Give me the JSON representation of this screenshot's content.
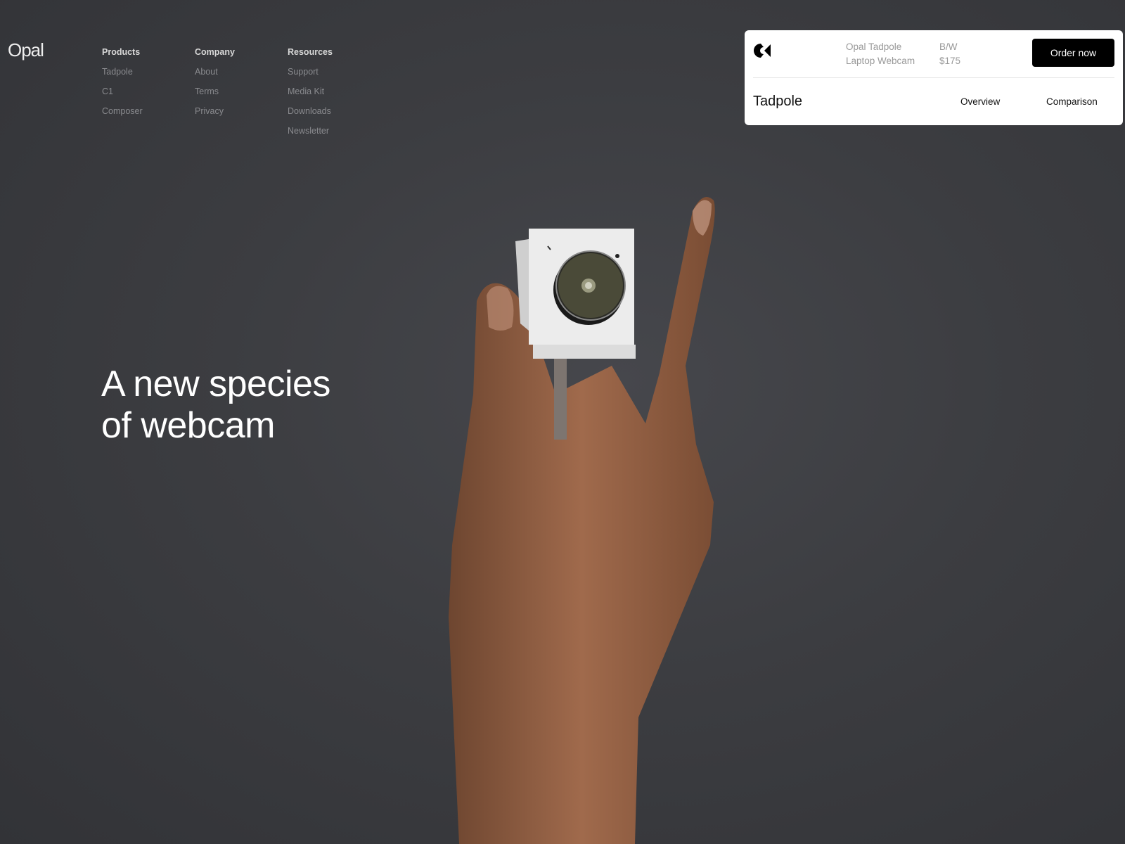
{
  "brand": {
    "logo": "Opal"
  },
  "nav": {
    "columns": [
      {
        "heading": "Products",
        "links": [
          "Tadpole",
          "C1",
          "Composer"
        ]
      },
      {
        "heading": "Company",
        "links": [
          "About",
          "Terms",
          "Privacy"
        ]
      },
      {
        "heading": "Resources",
        "links": [
          "Support",
          "Media Kit",
          "Downloads",
          "Newsletter"
        ]
      }
    ]
  },
  "hero": {
    "line1": "A new species",
    "line2": "of webcam"
  },
  "product_card": {
    "icon": "opal-c1-logo-icon",
    "name_line1": "Opal Tadpole",
    "name_line2": "Laptop Webcam",
    "variant": "B/W",
    "price": "$175",
    "order_label": "Order now",
    "title": "Tadpole",
    "tabs": [
      "Overview",
      "Comparison"
    ]
  }
}
